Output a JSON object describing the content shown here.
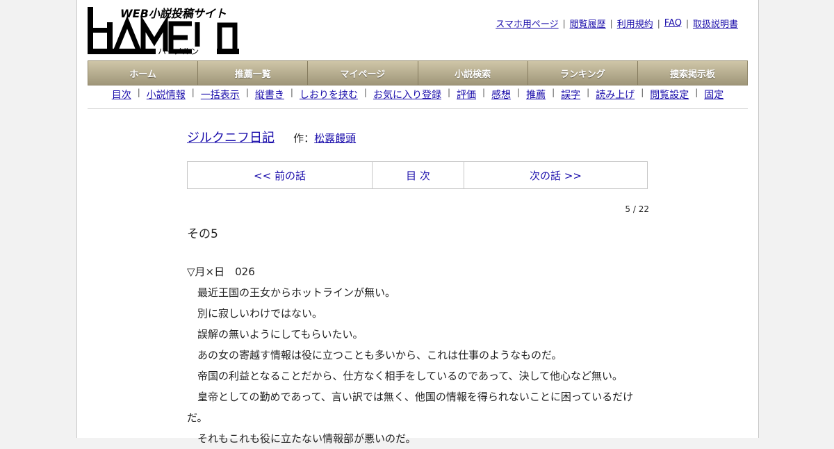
{
  "site": {
    "tagline": "WEB小説投稿サイト",
    "logo_text": "HAMELN",
    "logo_subtext": "ハーメルン"
  },
  "top_links": [
    "スマホ用ページ",
    "閲覧履歴",
    "利用規約",
    "FAQ",
    "取扱説明書"
  ],
  "main_nav": [
    "ホーム",
    "推薦一覧",
    "マイページ",
    "小説検索",
    "ランキング",
    "捜索掲示板"
  ],
  "sub_nav": [
    "目次",
    "小説情報",
    "一括表示",
    "縦書き",
    "しおりを挟む",
    "お気に入り登録",
    "評価",
    "感想",
    "推薦",
    "誤字",
    "読み上げ",
    "閲覧設定",
    "固定"
  ],
  "novel": {
    "title": "ジルクニフ日記",
    "author_prefix": "作：",
    "author": "松露饅頭"
  },
  "chapter_nav": {
    "prev": "<< 前の話",
    "toc": "目 次",
    "next": "次の話 >>"
  },
  "page_count": "5 / 22",
  "chapter_title": "その5",
  "body_lines": [
    "▽月×日　026",
    "　最近王国の王女からホットラインが無い。",
    "　別に寂しいわけではない。",
    "　誤解の無いようにしてもらいたい。",
    "　あの女の寄越す情報は役に立つことも多いから、これは仕事のようなものだ。",
    "　帝国の利益となることだから、仕方なく相手をしているのであって、決して他心など無い。",
    "　皇帝としての勤めであって、言い訳では無く、他国の情報を得られないことに困っているだけ",
    "だ。",
    "　それもこれも役に立たない情報部が悪いのだ。"
  ],
  "colors": {
    "link": "#1a0dab",
    "nav_top": "#cfc6a8",
    "nav_bottom": "#9f9679"
  }
}
